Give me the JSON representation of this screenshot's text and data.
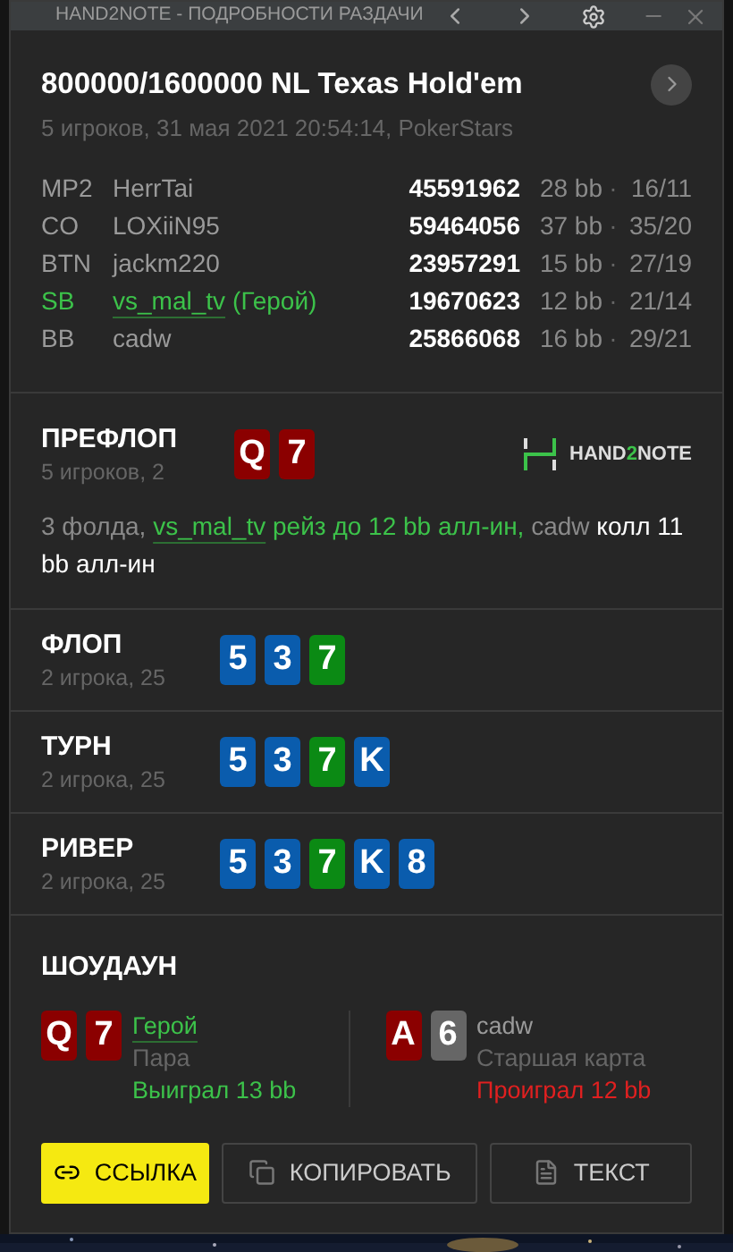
{
  "window": {
    "title": "HAND2NOTE - ПОДРОБНОСТИ РАЗДАЧИ"
  },
  "hand": {
    "title": "800000/1600000 NL Texas Hold'em",
    "subtitle": "5 игроков, 31 мая 2021 20:54:14, PokerStars"
  },
  "players": [
    {
      "position": "MP2",
      "name": "HerrTai",
      "hero": false,
      "id": "45591962",
      "stack": "28 bb",
      "separator": "·",
      "stats": "16/11"
    },
    {
      "position": "CO",
      "name": "LOXiiN95",
      "hero": false,
      "id": "59464056",
      "stack": "37 bb",
      "separator": "·",
      "stats": "35/20"
    },
    {
      "position": "BTN",
      "name": "jackm220",
      "hero": false,
      "id": "23957291",
      "stack": "15 bb",
      "separator": "·",
      "stats": "27/19"
    },
    {
      "position": "SB",
      "name": "vs_mal_tv",
      "hero": true,
      "hero_label": "(Герой)",
      "id": "19670623",
      "stack": "12 bb",
      "separator": "·",
      "stats": "21/14"
    },
    {
      "position": "BB",
      "name": "cadw",
      "hero": false,
      "id": "25866068",
      "stack": "16 bb",
      "separator": "·",
      "stats": "29/21"
    }
  ],
  "logo": [
    "HAND",
    "2",
    "NOTE"
  ],
  "streets": [
    {
      "name": "ПРЕФЛОП",
      "info": "5 игроков, 2",
      "cards": [
        {
          "rank": "Q",
          "color": "#8b0000"
        },
        {
          "rank": "7",
          "color": "#8b0000"
        }
      ],
      "actions": [
        {
          "kind": "plain",
          "text": "3 фолда, "
        },
        {
          "kind": "hero_link",
          "text": "vs_mal_tv"
        },
        {
          "kind": "hero",
          "text": " рейз до 12 bb алл-ин,"
        },
        {
          "kind": "plain",
          "text": " cadw"
        },
        {
          "kind": "action",
          "text": " колл 11 bb алл-ин"
        }
      ]
    },
    {
      "name": "ФЛОП",
      "info": "2 игрока, 25",
      "cards": [
        {
          "rank": "5",
          "color": "#0a5cad"
        },
        {
          "rank": "3",
          "color": "#0a5cad"
        },
        {
          "rank": "7",
          "color": "#0b8a14"
        }
      ]
    },
    {
      "name": "ТУРН",
      "info": "2 игрока, 25",
      "cards": [
        {
          "rank": "5",
          "color": "#0a5cad"
        },
        {
          "rank": "3",
          "color": "#0a5cad"
        },
        {
          "rank": "7",
          "color": "#0b8a14"
        },
        {
          "rank": "K",
          "color": "#0a5cad"
        }
      ]
    },
    {
      "name": "РИВЕР",
      "info": "2 игрока, 25",
      "cards": [
        {
          "rank": "5",
          "color": "#0a5cad"
        },
        {
          "rank": "3",
          "color": "#0a5cad"
        },
        {
          "rank": "7",
          "color": "#0b8a14"
        },
        {
          "rank": "K",
          "color": "#0a5cad"
        },
        {
          "rank": "8",
          "color": "#0a5cad"
        }
      ]
    }
  ],
  "showdown": {
    "title": "ШОУДАУН",
    "hands": [
      {
        "name": "Герой",
        "hero": true,
        "cards": [
          {
            "rank": "Q",
            "color": "#8b0000"
          },
          {
            "rank": "7",
            "color": "#8b0000"
          }
        ],
        "combo": "Пара",
        "result": "Выиграл 13 bb",
        "kind": "won"
      },
      {
        "name": "cadw",
        "hero": false,
        "cards": [
          {
            "rank": "A",
            "color": "#8b0000"
          },
          {
            "rank": "6",
            "color": "#666666"
          }
        ],
        "combo": "Старшая карта",
        "result": "Проиграл 12 bb",
        "kind": "lost"
      }
    ]
  },
  "buttons": [
    {
      "label": "ССЫЛКА",
      "kind": "primary"
    },
    {
      "label": "КОПИРОВАТЬ",
      "kind": "secondary"
    },
    {
      "label": "ТЕКСТ",
      "kind": "secondary"
    }
  ]
}
